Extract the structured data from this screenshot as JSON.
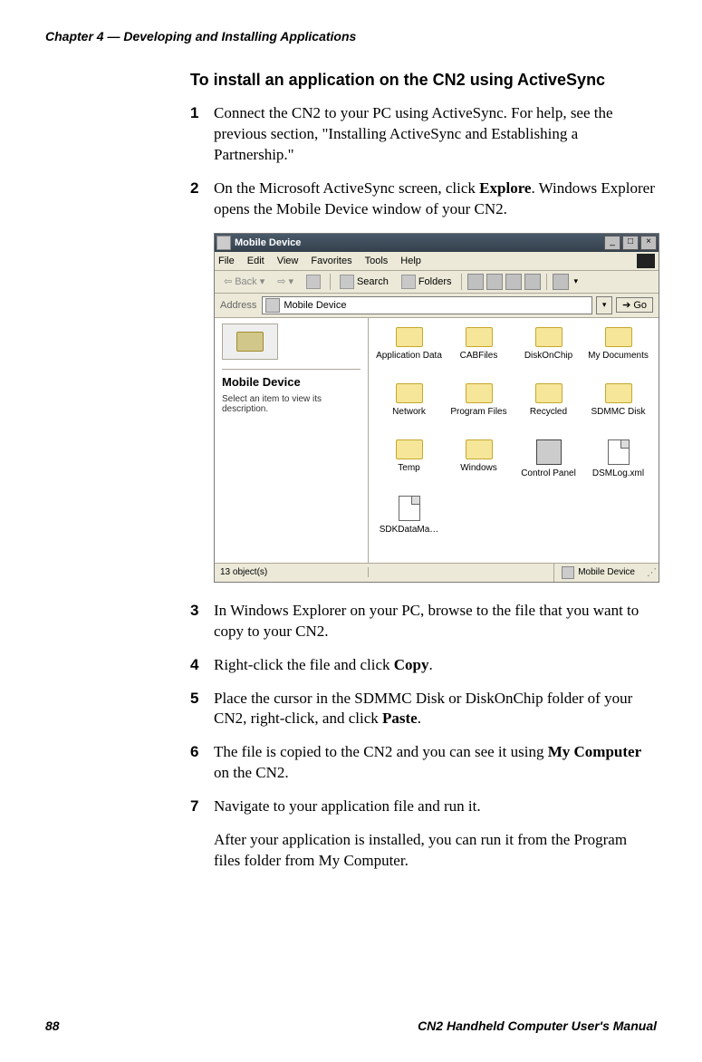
{
  "header": {
    "chapter": "Chapter 4 — Developing and Installing Applications"
  },
  "section": {
    "title": "To install an application on the CN2 using ActiveSync"
  },
  "steps": {
    "s1": "Connect the CN2 to your PC using ActiveSync. For help, see the previous section, \"Installing ActiveSync and Establishing a Partnership.\"",
    "s2_a": "On the Microsoft ActiveSync screen, click ",
    "s2_bold": "Explore",
    "s2_b": ". Windows Explorer opens the Mobile Device window of your CN2.",
    "s3": "In Windows Explorer on your PC, browse to the file that you want to copy to your CN2.",
    "s4_a": "Right-click the file and click ",
    "s4_bold": "Copy",
    "s4_b": ".",
    "s5_a": "Place the cursor in the SDMMC Disk or DiskOnChip folder of your CN2, right-click, and click ",
    "s5_bold": "Paste",
    "s5_b": ".",
    "s6_a": "The file is copied to the CN2 and you can see it using ",
    "s6_bold": "My Computer",
    "s6_b": " on the CN2.",
    "s7": "Navigate to your application file and run it."
  },
  "after": "After your application is installed, you can run it from the Program files folder from My Computer.",
  "footer": {
    "page": "88",
    "manual": "CN2 Handheld Computer User's Manual"
  },
  "screenshot": {
    "title": "Mobile Device",
    "menus": {
      "file": "File",
      "edit": "Edit",
      "view": "View",
      "favorites": "Favorites",
      "tools": "Tools",
      "help": "Help"
    },
    "toolbar": {
      "back": "Back",
      "search": "Search",
      "folders": "Folders"
    },
    "address": {
      "label": "Address",
      "value": "Mobile Device",
      "go": "Go"
    },
    "left": {
      "title": "Mobile Device",
      "desc": "Select an item to view its description."
    },
    "icons": {
      "r1c1": "Application Data",
      "r1c2": "CABFiles",
      "r1c3": "DiskOnChip",
      "r1c4": "My Documents",
      "r2c1": "Network",
      "r2c2": "Program Files",
      "r2c3": "Recycled",
      "r2c4": "SDMMC Disk",
      "r3c1": "Temp",
      "r3c2": "Windows",
      "r3c3": "Control Panel",
      "r3c4": "DSMLog.xml",
      "r4c1": "SDKDataMa…"
    },
    "status": {
      "left": "13 object(s)",
      "right": "Mobile Device"
    }
  }
}
